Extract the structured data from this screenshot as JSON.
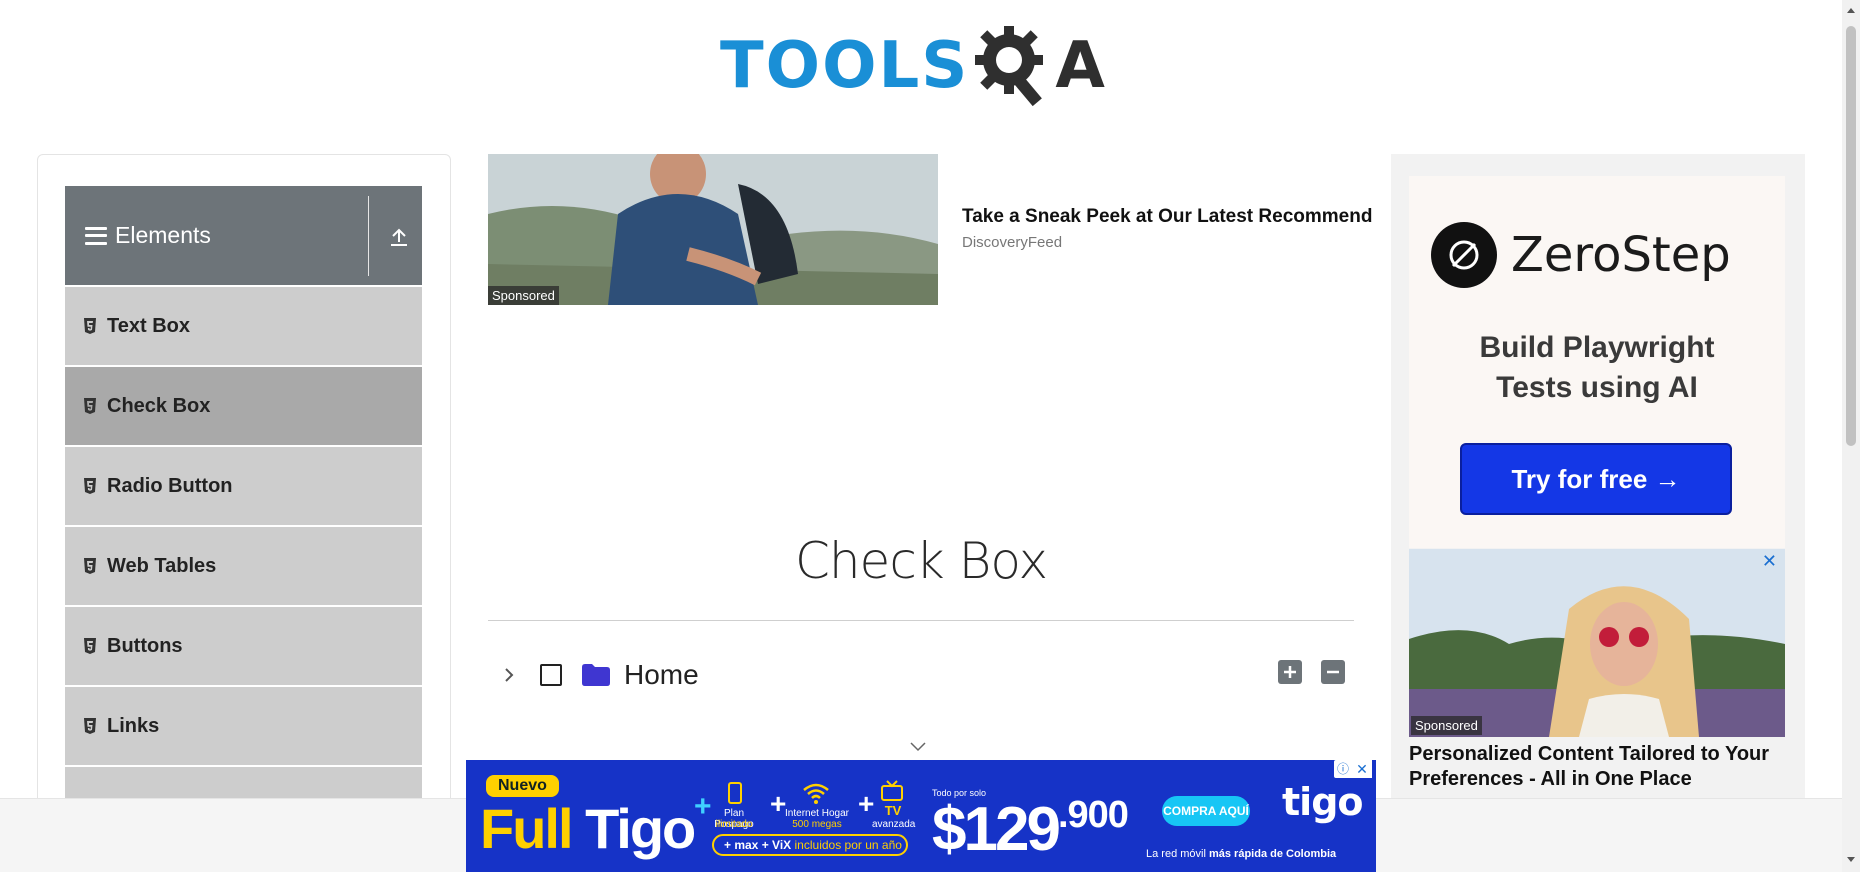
{
  "logo": {
    "part1": "TOOLS",
    "part2": "A"
  },
  "sidebar": {
    "group_title": "Elements",
    "items": [
      {
        "label": "Text Box",
        "active": false
      },
      {
        "label": "Check Box",
        "active": true
      },
      {
        "label": "Radio Button",
        "active": false
      },
      {
        "label": "Web Tables",
        "active": false
      },
      {
        "label": "Buttons",
        "active": false
      },
      {
        "label": "Links",
        "active": false
      }
    ]
  },
  "ad_top": {
    "sponsored": "Sponsored",
    "title": "Take a Sneak Peek at Our Latest Recommend",
    "source": "DiscoveryFeed"
  },
  "main": {
    "title": "Check Box",
    "tree": {
      "root_label": "Home",
      "checked": false,
      "expanded": false
    }
  },
  "right_ad": {
    "brand": "ZeroStep",
    "tagline_line1": "Build Playwright",
    "tagline_line2": "Tests using AI",
    "cta": "Try for free →",
    "sponsored": "Sponsored",
    "close": "✕",
    "title": "Personalized Content Tailored to Your Preferences - All in One Place"
  },
  "banner": {
    "nuevo": "Nuevo",
    "full": "Full",
    "tigo": "Tigo",
    "plus": "+",
    "item1_line1": "Plan Pospago",
    "item1_line2": "ilimitado",
    "item2_line1": "Internet Hogar",
    "item2_line2": "500 megas",
    "item3_line1": "TV",
    "item3_line2": "avanzada",
    "pill_max": "+ max",
    "pill_vix": "+ ViX",
    "pill_text": "incluidos por un año",
    "price_label": "Todo por solo",
    "price": "$129",
    "price_cents": ".900",
    "cta": "COMPRA AQUÍ",
    "brand": "tigo",
    "slogan_pre": "La red móvil",
    "slogan_bold": "más rápida de Colombia",
    "ad_info": "ⓘ",
    "ad_close": "✕"
  },
  "colors": {
    "logo_blue": "#1a8fd6",
    "sidebar_header": "#6d7479",
    "menu_item": "#cdcdcd",
    "menu_item_active": "#a9a9a9",
    "zerostep_button": "#1437e6",
    "banner_bg": "#1633c7",
    "banner_yellow": "#ffd000",
    "folder": "#3f36d1"
  }
}
